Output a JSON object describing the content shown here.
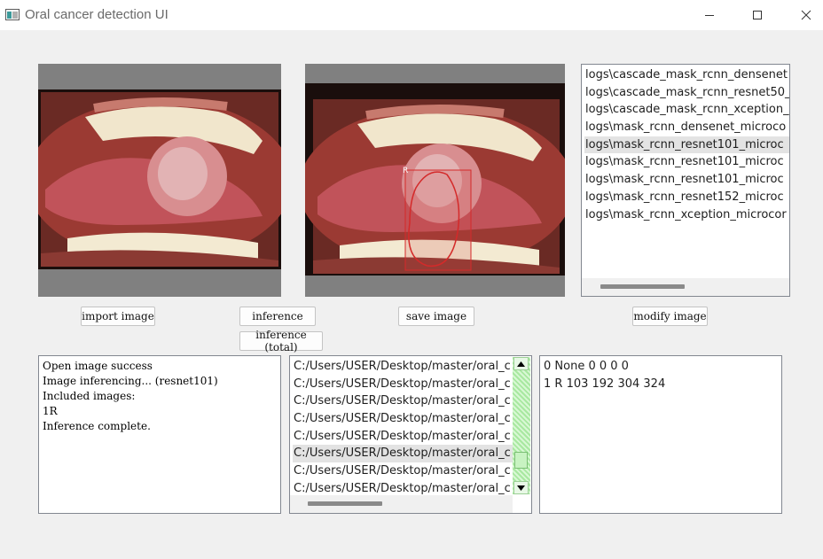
{
  "window": {
    "title": "Oral cancer detection UI",
    "controls": [
      "minimize-icon",
      "maximize-icon",
      "close-icon"
    ]
  },
  "images": {
    "original": {
      "label": "original mouth photo"
    },
    "result": {
      "detection_label": "R"
    }
  },
  "models_list": {
    "items": [
      "logs\\cascade_mask_rcnn_densenet",
      "logs\\cascade_mask_rcnn_resnet50_",
      "logs\\cascade_mask_rcnn_xception_",
      "logs\\mask_rcnn_densenet_microco",
      "logs\\mask_rcnn_resnet101_microc",
      "logs\\mask_rcnn_resnet101_microc",
      "logs\\mask_rcnn_resnet101_microc",
      "logs\\mask_rcnn_resnet152_microc",
      "logs\\mask_rcnn_xception_microcor"
    ],
    "selected_index": 4
  },
  "buttons": {
    "import": "import image",
    "inference": "inference",
    "inference_total": "inference (total)",
    "save": "save image",
    "modify": "modify image"
  },
  "log": {
    "lines": [
      "Open image success",
      "Image inferencing... (resnet101)",
      "Included images:",
      "1R",
      "Inference complete."
    ]
  },
  "files_list": {
    "items": [
      "C:/Users/USER/Desktop/master/oral_c",
      "C:/Users/USER/Desktop/master/oral_c",
      "C:/Users/USER/Desktop/master/oral_c",
      "C:/Users/USER/Desktop/master/oral_c",
      "C:/Users/USER/Desktop/master/oral_c",
      "C:/Users/USER/Desktop/master/oral_c",
      "C:/Users/USER/Desktop/master/oral_c",
      "C:/Users/USER/Desktop/master/oral_c"
    ],
    "selected_index": 5
  },
  "results": {
    "lines": [
      "0 None 0 0 0 0",
      "1 R 103 192 304 324"
    ]
  },
  "colors": {
    "scrollbar_accent": "#b7f0b0",
    "detection_outline": "#d42a2a"
  }
}
